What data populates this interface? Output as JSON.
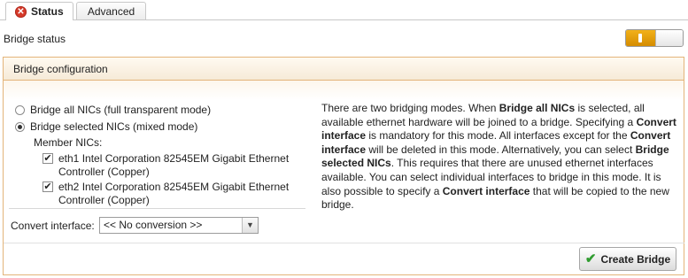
{
  "tabs": [
    {
      "label": "Status",
      "active": true,
      "icon": "error-icon"
    },
    {
      "label": "Advanced",
      "active": false
    }
  ],
  "bridge_status": {
    "label": "Bridge status",
    "enabled": true
  },
  "config": {
    "title": "Bridge configuration",
    "mode_options": [
      {
        "label": "Bridge all NICs (full transparent mode)",
        "selected": false
      },
      {
        "label": "Bridge selected NICs (mixed mode)",
        "selected": true
      }
    ],
    "member_label": "Member NICs:",
    "nics": [
      {
        "line1": "eth1 Intel Corporation 82545EM Gigabit Ethernet",
        "line2": "Controller (Copper)",
        "checked": true
      },
      {
        "line1": "eth2 Intel Corporation 82545EM Gigabit Ethernet",
        "line2": "Controller (Copper)",
        "checked": true
      }
    ],
    "convert_label": "Convert interface:",
    "convert_value": "<< No conversion >>",
    "help": [
      {
        "t": "There are two bridging modes. When ",
        "b": false
      },
      {
        "t": "Bridge all NICs",
        "b": true
      },
      {
        "t": " is selected, all available ethernet hardware will be joined to a bridge. Specifying a ",
        "b": false
      },
      {
        "t": "Convert interface",
        "b": true
      },
      {
        "t": " is mandatory for this mode. All interfaces except for the ",
        "b": false
      },
      {
        "t": "Convert interface",
        "b": true
      },
      {
        "t": " will be deleted in this mode. Alternatively, you can select ",
        "b": false
      },
      {
        "t": "Bridge selected NICs",
        "b": true
      },
      {
        "t": ". This requires that there are unused ethernet interfaces available. You can select individual interfaces to bridge in this mode. It is also possible to specify a ",
        "b": false
      },
      {
        "t": "Convert interface",
        "b": true
      },
      {
        "t": " that will be copied to the new bridge.",
        "b": false
      }
    ],
    "create_button": "Create Bridge"
  },
  "colors": {
    "accent": "#f2b11a",
    "panel_border": "#e3b47a",
    "error": "#d63a2a",
    "check": "#2f9c2f"
  }
}
